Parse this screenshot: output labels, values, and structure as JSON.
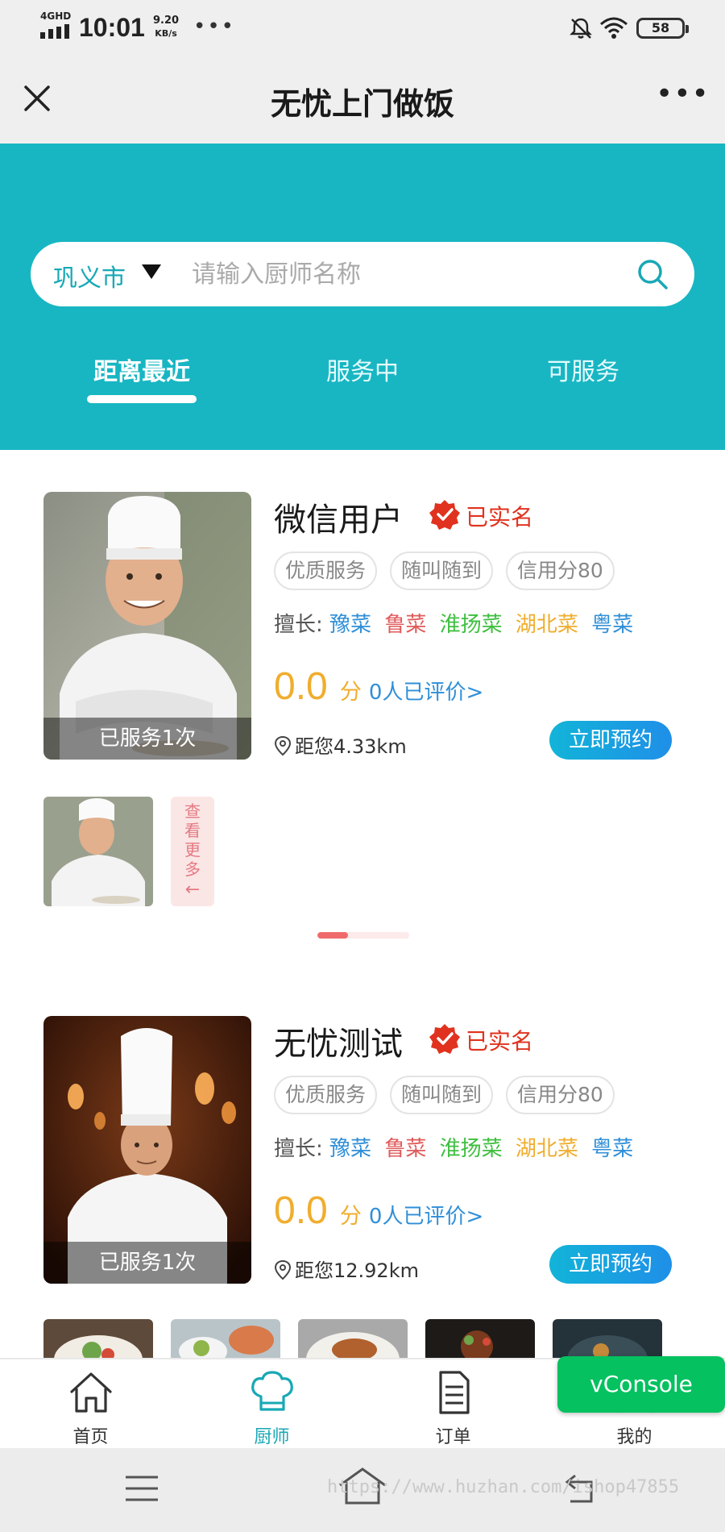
{
  "status_bar": {
    "network": "4GHD",
    "time": "10:01",
    "speed_value": "9.20",
    "speed_unit": "KB/s",
    "battery": "58"
  },
  "title_bar": {
    "title": "无忧上门做饭"
  },
  "search": {
    "city": "巩义市",
    "placeholder": "请输入厨师名称"
  },
  "tabs": [
    {
      "label": "距离最近",
      "active": true
    },
    {
      "label": "服务中",
      "active": false
    },
    {
      "label": "可服务",
      "active": false
    }
  ],
  "chefs": [
    {
      "name": "微信用户",
      "verified": "已实名",
      "served": "已服务1次",
      "tags": [
        "优质服务",
        "随叫随到",
        "信用分80"
      ],
      "skills_label": "擅长:",
      "skills": [
        "豫菜",
        "鲁菜",
        "淮扬菜",
        "湖北菜",
        "粤菜"
      ],
      "score": "0.0",
      "score_unit": "分",
      "review_count": "0人已评价>",
      "distance": "距您4.33km",
      "book": "立即预约",
      "see_more": "查看更多",
      "see_more_arrow": "←"
    },
    {
      "name": "无忧测试",
      "verified": "已实名",
      "served": "已服务1次",
      "tags": [
        "优质服务",
        "随叫随到",
        "信用分80"
      ],
      "skills_label": "擅长:",
      "skills": [
        "豫菜",
        "鲁菜",
        "淮扬菜",
        "湖北菜",
        "粤菜"
      ],
      "score": "0.0",
      "score_unit": "分",
      "review_count": "0人已评价>",
      "distance": "距您12.92km",
      "book": "立即预约"
    }
  ],
  "pager": {
    "active_fraction": 0.33
  },
  "skill_colors": [
    "#2f8fd8",
    "#e05a5a",
    "#3fbf3f",
    "#f0ad2e",
    "#2f8fd8"
  ],
  "bottom_nav": [
    {
      "label": "首页",
      "icon": "home-icon",
      "active": false
    },
    {
      "label": "厨师",
      "icon": "chef-hat-icon",
      "active": true
    },
    {
      "label": "订单",
      "icon": "order-icon",
      "active": false
    },
    {
      "label": "我的",
      "icon": "profile-icon",
      "active": false
    }
  ],
  "vconsole": "vConsole",
  "watermark": "https://www.huzhan.com/ishop47855",
  "colors": {
    "header": "#18b6c3",
    "verified": "#e0321e",
    "score": "#f0ad2e",
    "button": "#1aa5e0",
    "vconsole": "#05c160"
  }
}
